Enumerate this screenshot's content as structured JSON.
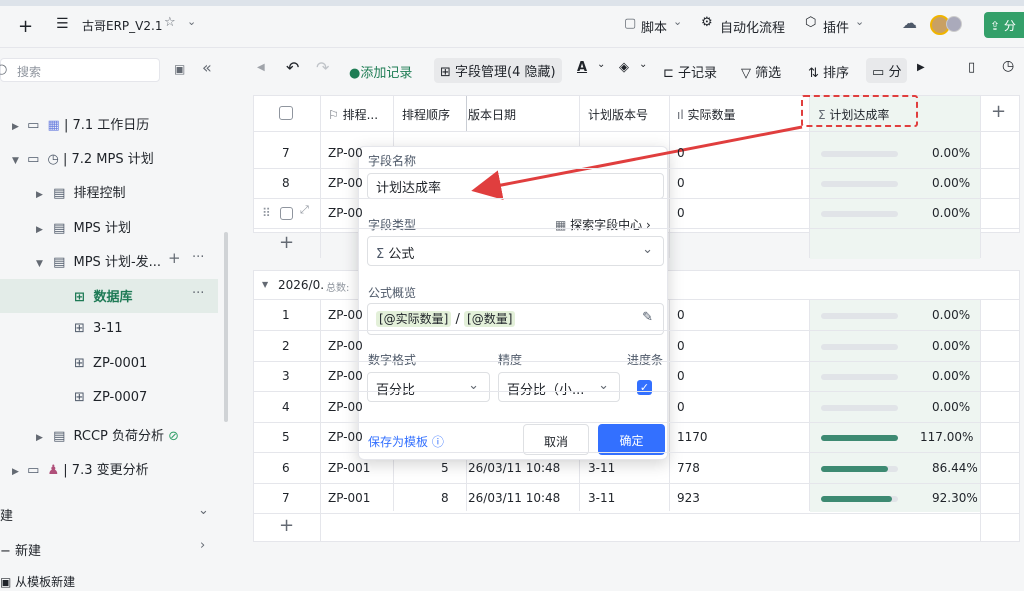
{
  "app": {
    "title": "古哥ERP_V2.1",
    "plus_icon": "plus-icon",
    "menu_icon": "menu-icon"
  },
  "topbar": {
    "script_label": "脚本",
    "automation_label": "自动化流程",
    "plugin_label": "插件",
    "share_label": "分"
  },
  "sidebar": {
    "search_placeholder": "搜索",
    "items": [
      {
        "label": "| 7.1 工作日历",
        "level": 1
      },
      {
        "label": "| 7.2 MPS 计划",
        "level": 1
      },
      {
        "label": "排程控制",
        "level": 2
      },
      {
        "label": "MPS 计划",
        "level": 2
      },
      {
        "label": "MPS 计划-发...",
        "level": 2
      },
      {
        "label": "数据库",
        "level": 3
      },
      {
        "label": "3-11",
        "level": 3
      },
      {
        "label": "ZP-0001",
        "level": 3
      },
      {
        "label": "ZP-0007",
        "level": 3
      },
      {
        "label": "RCCP 负荷分析",
        "level": 2
      },
      {
        "label": "| 7.3 变更分析",
        "level": 1
      }
    ],
    "footer": [
      {
        "label": "建"
      },
      {
        "label": "新建"
      },
      {
        "label": "从模板新建"
      }
    ]
  },
  "toolbar": {
    "add_record": "添加记录",
    "field_manage": "字段管理(4 隐藏)",
    "sub_record": "子记录",
    "filter": "筛选",
    "sort": "排序",
    "group": "分"
  },
  "table": {
    "headers": [
      "排程...",
      "排程顺序",
      "版本日期",
      "计划版本号",
      "实际数量",
      "计划达成率"
    ],
    "group1_rows": [
      {
        "idx": "7",
        "code": "ZP-00",
        "actual": "0",
        "rate": "0.00%",
        "pct": 0
      },
      {
        "idx": "8",
        "code": "ZP-00",
        "actual": "0",
        "rate": "0.00%",
        "pct": 0
      },
      {
        "idx": "",
        "code": "ZP-00",
        "actual": "0",
        "rate": "0.00%",
        "pct": 0
      }
    ],
    "group2_label": "2026/0.",
    "group2_total": "总数:",
    "group2_rows": [
      {
        "idx": "1",
        "code": "ZP-00",
        "order": "",
        "date": "",
        "version": "",
        "actual": "0",
        "rate": "0.00%",
        "pct": 0
      },
      {
        "idx": "2",
        "code": "ZP-00",
        "order": "",
        "date": "",
        "version": "",
        "actual": "0",
        "rate": "0.00%",
        "pct": 0
      },
      {
        "idx": "3",
        "code": "ZP-00",
        "order": "",
        "date": "",
        "version": "",
        "actual": "0",
        "rate": "0.00%",
        "pct": 0
      },
      {
        "idx": "4",
        "code": "ZP-00",
        "order": "",
        "date": "",
        "version": "",
        "actual": "0",
        "rate": "0.00%",
        "pct": 0
      },
      {
        "idx": "5",
        "code": "ZP-00",
        "order": "",
        "date": "",
        "version": "",
        "actual": "1170",
        "rate": "117.00%",
        "pct": 100
      },
      {
        "idx": "6",
        "code": "ZP-001",
        "order": "5",
        "date": "26/03/11 10:48",
        "version": "3-11",
        "actual": "778",
        "rate": "86.44%",
        "pct": 86.44
      },
      {
        "idx": "7",
        "code": "ZP-001",
        "order": "8",
        "date": "26/03/11 10:48",
        "version": "3-11",
        "actual": "923",
        "rate": "92.30%",
        "pct": 92.3
      }
    ]
  },
  "popup": {
    "field_name_label": "字段名称",
    "field_name_value": "计划达成率",
    "field_type_label": "字段类型",
    "explore_label": "探索字段中心",
    "field_type_value": "公式",
    "formula_label": "公式概览",
    "formula_a": "[@实际数量]",
    "formula_sep": "/",
    "formula_b": "[@数量]",
    "number_format_label": "数字格式",
    "precision_label": "精度",
    "progress_label": "进度条",
    "number_format_value": "百分比",
    "precision_value": "百分比（小...",
    "save_template": "保存为模板",
    "cancel": "取消",
    "confirm": "确定"
  },
  "colors": {
    "accent": "#34a06a",
    "primary": "#3370ff",
    "annotation": "#e03e3e",
    "bar": "#3d8a72"
  }
}
